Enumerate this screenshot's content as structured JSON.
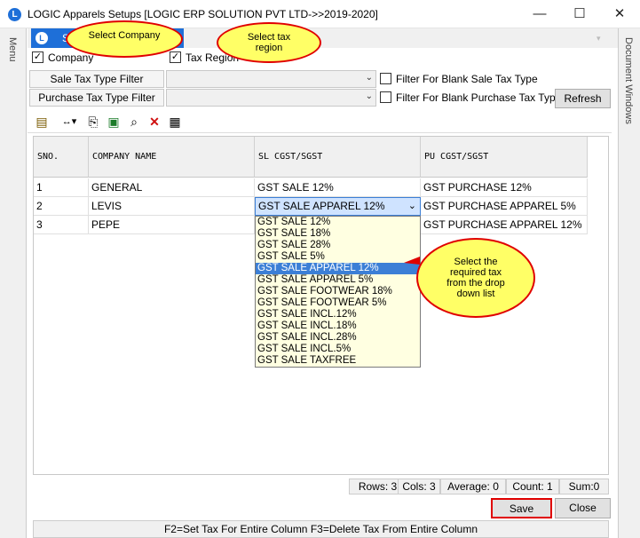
{
  "window": {
    "title": "LOGIC Apparels Setups  [LOGIC ERP SOLUTION PVT LTD->>2019-2020]",
    "app_icon": "L",
    "minimize": "—",
    "maximize": "☐",
    "close": "✕"
  },
  "sidebars": {
    "left": "Menu",
    "right": "Document Windows"
  },
  "tab": {
    "icon": "L",
    "label": "S"
  },
  "checkboxes": {
    "company": {
      "label": "Company",
      "checked": true
    },
    "tax_region": {
      "label": "Tax Region",
      "checked": true
    }
  },
  "filters": {
    "sale_label": "Sale Tax Type Filter",
    "purchase_label": "Purchase Tax Type Filter",
    "sale_value": "",
    "purchase_value": "",
    "blank_sale_label": "Filter For Blank Sale Tax Type",
    "blank_purchase_label": "Filter For Blank Purchase Tax Type",
    "refresh_label": "Refresh"
  },
  "toolbar": {
    "icons": [
      "export-icon",
      "column-width-icon",
      "copy-icon",
      "excel-icon",
      "find-icon",
      "delete-icon",
      "grid-icon"
    ]
  },
  "grid": {
    "columns": [
      "SNO.",
      "COMPANY NAME",
      "SL CGST/SGST",
      "PU CGST/SGST"
    ],
    "rows": [
      [
        "1",
        "GENERAL",
        "GST SALE 12%",
        "GST PURCHASE 12%"
      ],
      [
        "2",
        "LEVIS",
        "GST SALE APPAREL 12%",
        "GST PURCHASE APPAREL 5%"
      ],
      [
        "3",
        "PEPE",
        "",
        "GST PURCHASE APPAREL 12%"
      ]
    ]
  },
  "dropdown": {
    "selected": "GST SALE APPAREL 12%",
    "options": [
      "GST SALE 12%",
      "GST SALE 18%",
      "GST SALE 28%",
      "GST SALE 5%",
      "GST SALE APPAREL 12%",
      "GST SALE APPAREL 5%",
      "GST SALE FOOTWEAR 18%",
      "GST SALE FOOTWEAR 5%",
      "GST SALE INCL.12%",
      "GST SALE INCL.18%",
      "GST SALE INCL.28%",
      "GST SALE INCL.5%",
      "GST SALE TAXFREE"
    ],
    "selected_index": 4
  },
  "callouts": {
    "select_company": "Select  Company",
    "select_tax_region": "Select  tax region",
    "select_tax": "Select  the required  tax  from the  drop  down list"
  },
  "status": {
    "rows": "Rows: 3",
    "cols": "Cols: 3",
    "average": "Average: 0",
    "count": "Count: 1",
    "sum": "Sum:0"
  },
  "buttons": {
    "save": "Save",
    "close": "Close"
  },
  "hint": "F2=Set Tax For Entire Column  F3=Delete Tax From Entire Column",
  "colors": {
    "accent": "#1e6fd8",
    "callout_fill": "#ffff66",
    "callout_border": "#e00000",
    "dropdown_bg": "#ffffe1"
  }
}
